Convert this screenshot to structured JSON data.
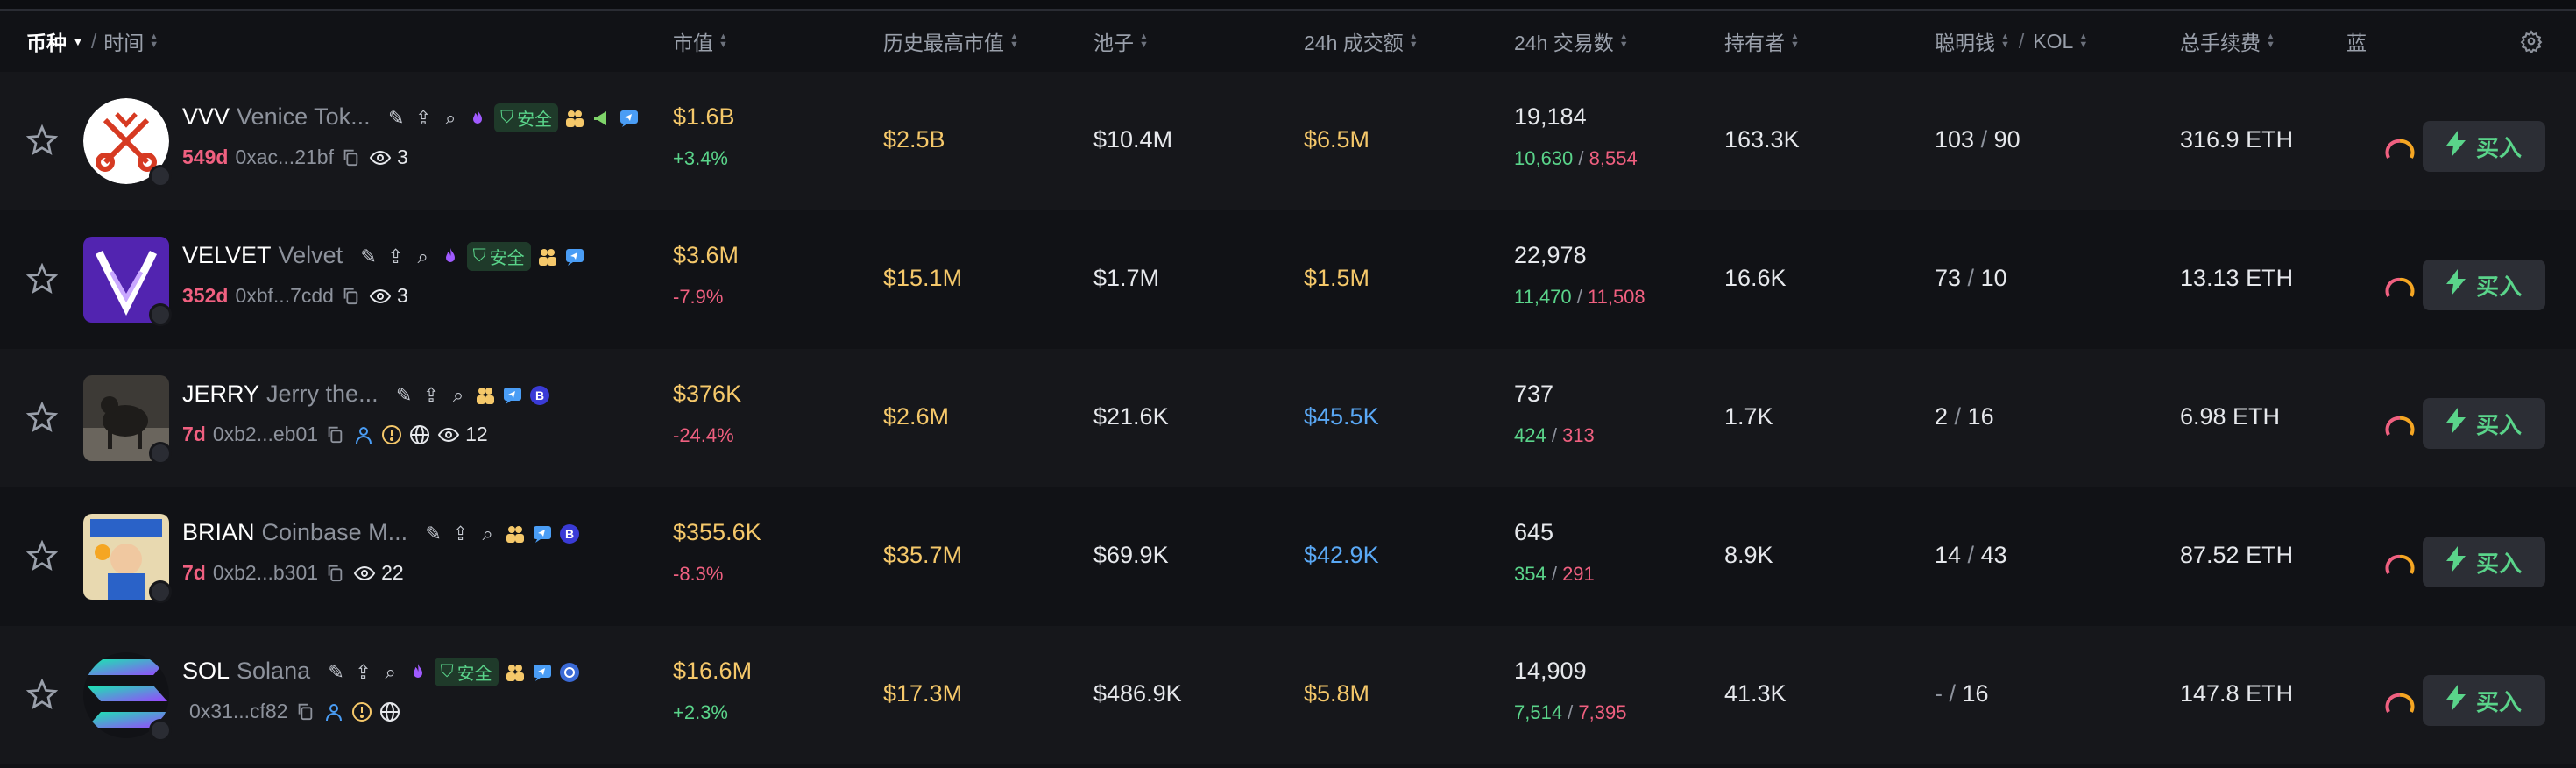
{
  "header": {
    "coin": "币种",
    "time": "时间",
    "market_cap": "市值",
    "ath_mc": "历史最高市值",
    "pool": "池子",
    "vol24": "24h 成交额",
    "tx24": "24h 交易数",
    "holders": "持有者",
    "smart": "聪明钱",
    "kol": "KOL",
    "fees": "总手续费",
    "blue": "蓝"
  },
  "buy_label": "买入",
  "safe_label": "安全",
  "rows": [
    {
      "symbol": "VVV",
      "name": "Venice Tok...",
      "age": "549d",
      "address": "0xac...21bf",
      "views": "3",
      "mc": "$1.6B",
      "mc_change": "+3.4%",
      "ath": "$2.5B",
      "pool": "$10.4M",
      "vol": "$6.5M",
      "tx": "19,184",
      "buys": "10,630",
      "sells": "8,554",
      "holders": "163.3K",
      "smart": "103",
      "kol": "90",
      "fees": "316.9 ETH"
    },
    {
      "symbol": "VELVET",
      "name": "Velvet",
      "age": "352d",
      "address": "0xbf...7cdd",
      "views": "3",
      "mc": "$3.6M",
      "mc_change": "-7.9%",
      "ath": "$15.1M",
      "pool": "$1.7M",
      "vol": "$1.5M",
      "tx": "22,978",
      "buys": "11,470",
      "sells": "11,508",
      "holders": "16.6K",
      "smart": "73",
      "kol": "10",
      "fees": "13.13 ETH"
    },
    {
      "symbol": "JERRY",
      "name": "Jerry the...",
      "age": "7d",
      "address": "0xb2...eb01",
      "views": "12",
      "mc": "$376K",
      "mc_change": "-24.4%",
      "ath": "$2.6M",
      "pool": "$21.6K",
      "vol": "$45.5K",
      "tx": "737",
      "buys": "424",
      "sells": "313",
      "holders": "1.7K",
      "smart": "2",
      "kol": "16",
      "fees": "6.98 ETH"
    },
    {
      "symbol": "BRIAN",
      "name": "Coinbase M...",
      "age": "7d",
      "address": "0xb2...b301",
      "views": "22",
      "mc": "$355.6K",
      "mc_change": "-8.3%",
      "ath": "$35.7M",
      "pool": "$69.9K",
      "vol": "$42.9K",
      "tx": "645",
      "buys": "354",
      "sells": "291",
      "holders": "8.9K",
      "smart": "14",
      "kol": "43",
      "fees": "87.52 ETH"
    },
    {
      "symbol": "SOL",
      "name": "Solana",
      "age": "",
      "address": "0x31...cf82",
      "views": "",
      "mc": "$16.6M",
      "mc_change": "+2.3%",
      "ath": "$17.3M",
      "pool": "$486.9K",
      "vol": "$5.8M",
      "tx": "14,909",
      "buys": "7,514",
      "sells": "7,395",
      "holders": "41.3K",
      "smart": "-",
      "kol": "16",
      "fees": "147.8 ETH"
    }
  ],
  "colors": {
    "background": "#111216",
    "row_alt": "#16171b",
    "green": "#5ad48a",
    "red": "#f06080",
    "yellow": "#f5c86a",
    "blue": "#5aa8f5"
  }
}
